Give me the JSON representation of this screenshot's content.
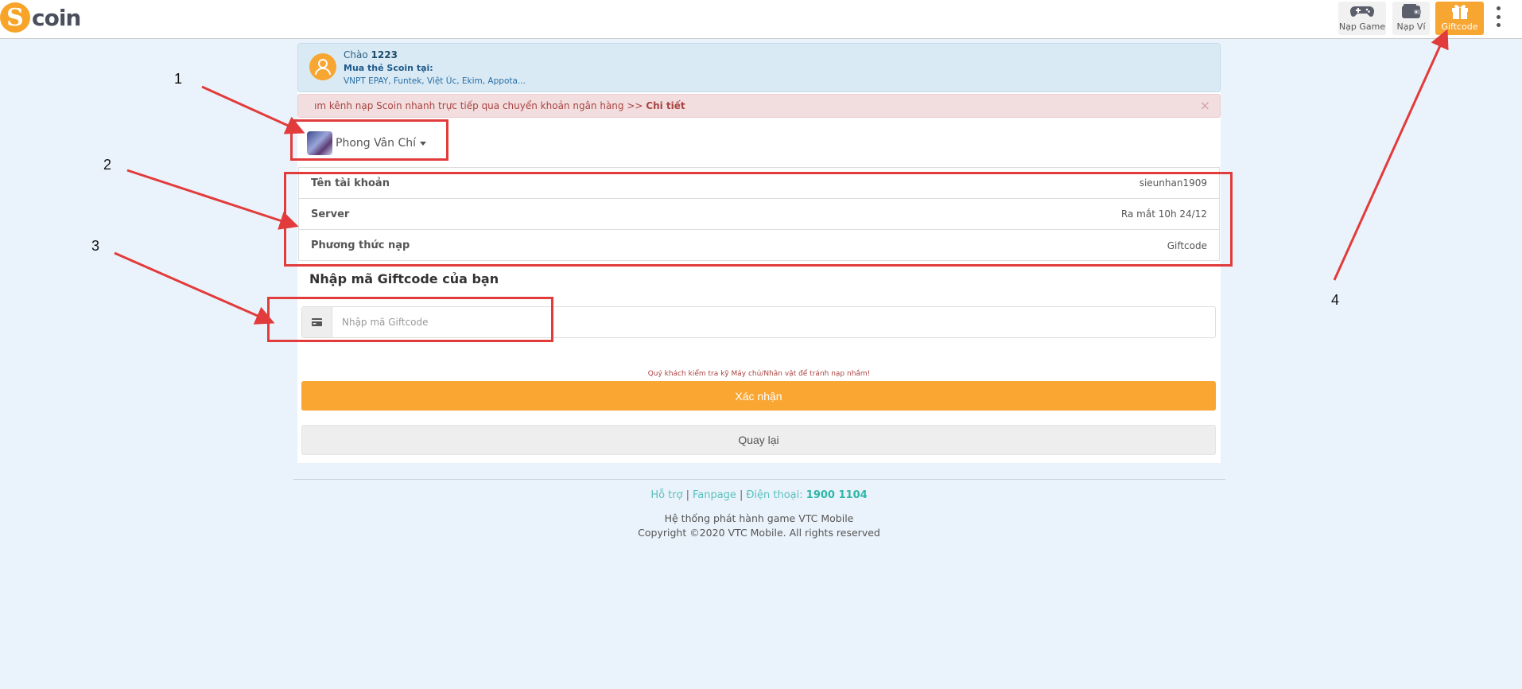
{
  "header": {
    "logo_letter": "S",
    "logo_text": "coin",
    "nav": [
      {
        "label": "Nạp Game",
        "icon": "gamepad-icon"
      },
      {
        "label": "Nạp Ví",
        "icon": "wallet-icon"
      },
      {
        "label": "Giftcode",
        "icon": "gift-icon",
        "active": true
      }
    ],
    "menu_icon": "kebab-menu-icon"
  },
  "greeting": {
    "hello_prefix": "Chào",
    "username": "1223",
    "buy_label": "Mua thẻ Scoin tại:",
    "providers": "VNPT EPAY, Funtek, Việt Úc, Ekim, Appota..."
  },
  "alert": {
    "text": "ım kênh nạp Scoin nhanh trực tiếp qua chuyển khoản ngân hàng >>",
    "link": "Chi tiết",
    "close": "×"
  },
  "game": {
    "name": "Phong Vân Chí"
  },
  "info": [
    {
      "label": "Tên tài khoản",
      "value": "sieunhan1909"
    },
    {
      "label": "Server",
      "value": "Ra mắt 10h 24/12"
    },
    {
      "label": "Phương thức nạp",
      "value": "Giftcode"
    }
  ],
  "form": {
    "title": "Nhập mã Giftcode của bạn",
    "placeholder": "Nhập mã Giftcode",
    "note": "Quý khách kiểm tra kỹ Máy chủ/Nhân vật để tránh nạp nhầm!",
    "confirm_label": "Xác nhận",
    "back_label": "Quay lại"
  },
  "footer": {
    "support": "Hỗ trợ",
    "fanpage": "Fanpage",
    "phone_label": "Điện thoại:",
    "phone": "1900 1104",
    "system": "Hệ thống phát hành game VTC Mobile",
    "copyright": "Copyright ©2020 VTC Mobile. All rights reserved"
  },
  "annotations": {
    "n1": "1",
    "n2": "2",
    "n3": "3",
    "n4": "4",
    "color": "#e23b3b"
  },
  "colors": {
    "accent": "#f9a633",
    "background": "#eaf3fb",
    "info_box": "#d9eaf5",
    "alert_bg": "#f2dede",
    "alert_text": "#a94442",
    "footer_link": "#2fb7a8"
  }
}
